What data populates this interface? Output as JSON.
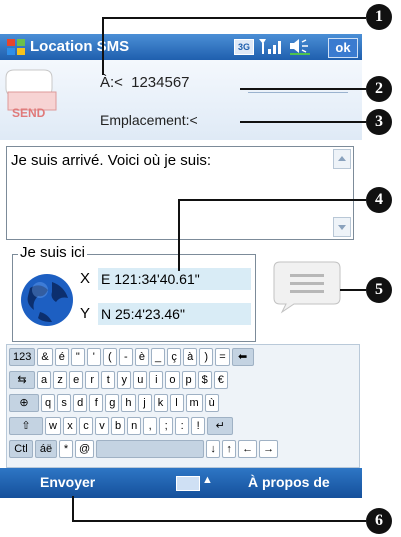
{
  "titlebar": {
    "title": "Location SMS",
    "network_badge": "3G",
    "ok_label": "ok"
  },
  "header": {
    "to_label": "À:<",
    "to_value": "1234567",
    "location_label": "Emplacement:<",
    "send_icon_text": "SEND"
  },
  "message": {
    "text": "Je suis arrivé. Voici où je suis:"
  },
  "location": {
    "group_label": "Je suis ici",
    "x_label": "X",
    "y_label": "Y",
    "x_value": "E 121:34'40.61\"",
    "y_value": "N 25:4'23.46\""
  },
  "keyboard": {
    "rows": [
      [
        "123",
        "&",
        "é",
        "\"",
        "'",
        "(",
        "-",
        "è",
        "_",
        "ç",
        "à",
        ")",
        "=",
        "⬅"
      ],
      [
        "⇆",
        "a",
        "z",
        "e",
        "r",
        "t",
        "y",
        "u",
        "i",
        "o",
        "p",
        "$",
        "€"
      ],
      [
        "⊕",
        "q",
        "s",
        "d",
        "f",
        "g",
        "h",
        "j",
        "k",
        "l",
        "m",
        "ù"
      ],
      [
        "⇧",
        "w",
        "x",
        "c",
        "v",
        "b",
        "n",
        ",",
        ";",
        ":",
        "!",
        "↵"
      ],
      [
        "Ctl",
        "áë",
        "*",
        "@",
        " ",
        "↓",
        "↑",
        "←",
        "→"
      ]
    ]
  },
  "bottombar": {
    "left_label": "Envoyer",
    "right_label": "À propos de"
  },
  "callouts": [
    "1",
    "2",
    "3",
    "4",
    "5",
    "6"
  ]
}
